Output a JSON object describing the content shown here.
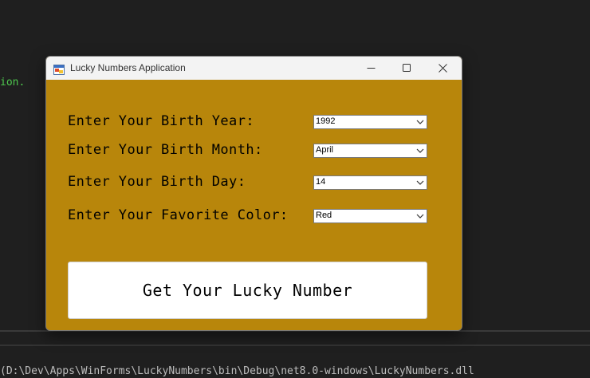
{
  "background": {
    "code_fragment": "ion.",
    "bottom_strip": "(D:\\Dev\\Apps\\WinForms\\LuckyNumbers\\bin\\Debug\\net8.0-windows\\LuckyNumbers.dll"
  },
  "window": {
    "title": "Lucky Numbers Application",
    "client_color": "#b8860b"
  },
  "form": {
    "year_label": "Enter Your Birth Year:",
    "year_value": "1992",
    "month_label": "Enter Your Birth Month:",
    "month_value": "April",
    "day_label": "Enter Your Birth Day:",
    "day_value": "14",
    "color_label": "Enter Your Favorite Color:",
    "color_value": "Red",
    "submit_label": "Get Your Lucky Number"
  }
}
